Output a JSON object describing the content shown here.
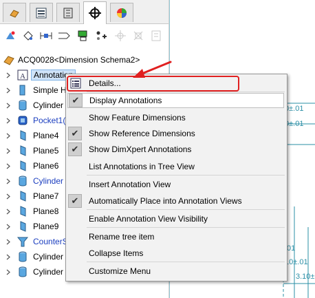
{
  "tabs": [
    "feature-manager-icon",
    "property-manager-icon",
    "configuration-manager-icon",
    "dimxpert-manager-icon",
    "display-manager-icon"
  ],
  "toolbar": [
    "auto-dimension-scheme-icon",
    "location-dimension-icon",
    "size-dimension-icon",
    "datum-icon",
    "geometric-tolerance-icon",
    "pattern-feature-icon",
    "show-tolerance-status-icon",
    "copy-scheme-icon",
    "delete-scheme-icon"
  ],
  "tree": {
    "root": "ACQ0028<Dimension Schema2>",
    "items": [
      {
        "label": "Annotation",
        "icon": "annotations-folder-icon",
        "blue": false
      },
      {
        "label": "Simple H",
        "icon": "simple-hole-icon",
        "blue": false
      },
      {
        "label": "Cylinder",
        "icon": "cylinder-icon",
        "blue": false
      },
      {
        "label": "Pocket1(",
        "icon": "pocket-icon",
        "blue": true
      },
      {
        "label": "Plane4",
        "icon": "plane-icon",
        "blue": false
      },
      {
        "label": "Plane5",
        "icon": "plane-icon",
        "blue": false
      },
      {
        "label": "Plane6",
        "icon": "plane-icon",
        "blue": false
      },
      {
        "label": "Cylinder",
        "icon": "cylinder-icon",
        "blue": true
      },
      {
        "label": "Plane7",
        "icon": "plane-icon",
        "blue": false
      },
      {
        "label": "Plane8",
        "icon": "plane-icon",
        "blue": false
      },
      {
        "label": "Plane9",
        "icon": "plane-icon",
        "blue": false
      },
      {
        "label": "CounterS",
        "icon": "countersink-icon",
        "blue": true
      },
      {
        "label": "Cylinder",
        "icon": "cylinder-icon",
        "blue": false
      },
      {
        "label": "Cylinder",
        "icon": "cylinder-icon",
        "blue": false
      }
    ]
  },
  "drawing": {
    "dims": [
      "0±.01",
      "0±.01",
      ".01",
      "10±.01",
      "3.10±"
    ]
  },
  "menu": {
    "details": "Details...",
    "display_annotations": "Display Annotations",
    "show_feature_dimensions": "Show Feature Dimensions",
    "show_reference_dimensions": "Show Reference Dimensions",
    "show_dimxpert_annotations": "Show DimXpert Annotations",
    "list_annotations": "List Annotations in Tree View",
    "insert_annotation_view": "Insert Annotation View",
    "auto_place": "Automatically Place into Annotation Views",
    "enable_visibility": "Enable Annotation View Visibility",
    "rename_tree_item": "Rename tree item",
    "collapse_items": "Collapse Items",
    "customize_menu": "Customize Menu"
  },
  "colors": {
    "accent_red": "#e02020",
    "tree_blue": "#1a3dbf",
    "dim_teal": "#2a8fa6"
  }
}
